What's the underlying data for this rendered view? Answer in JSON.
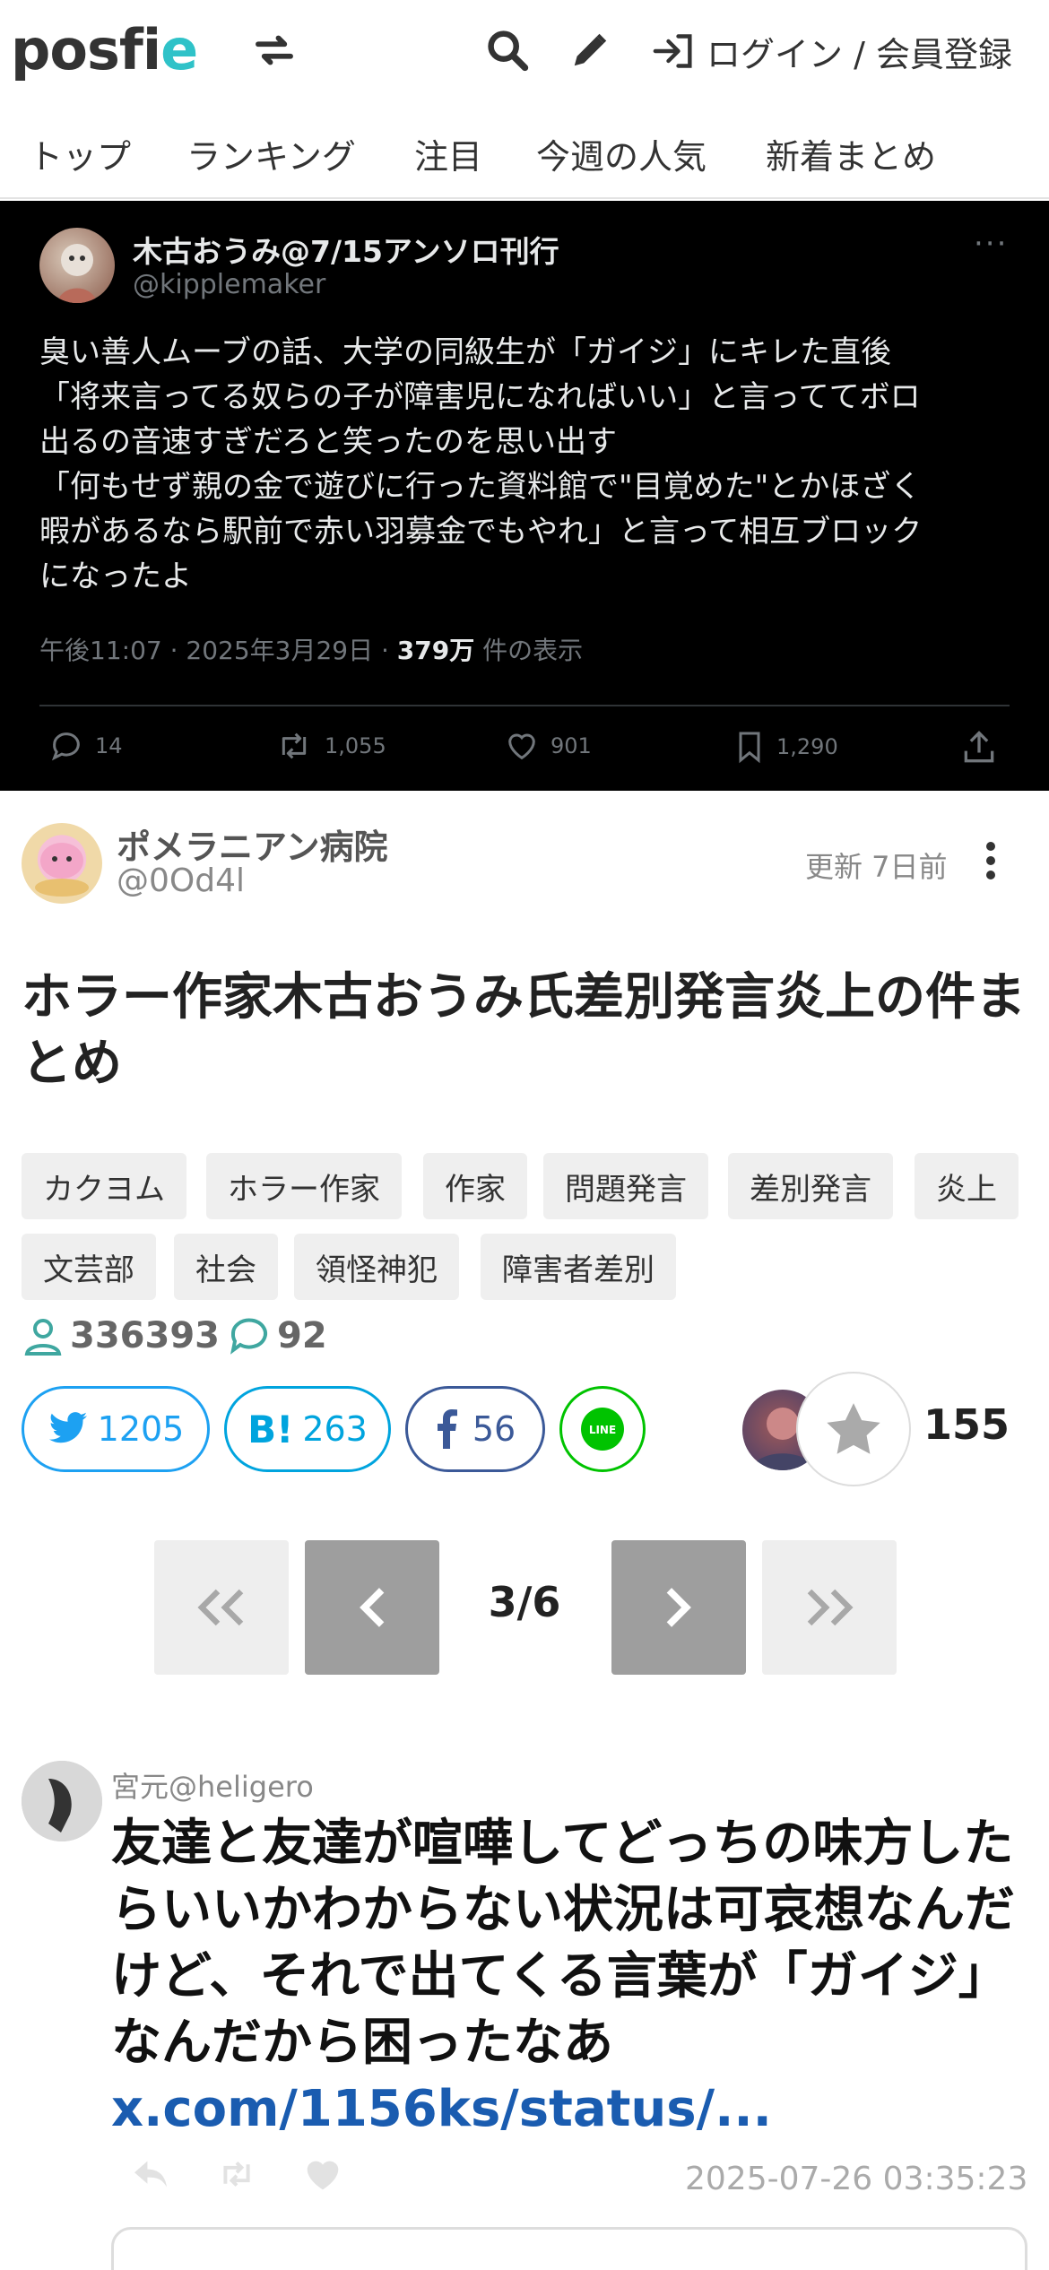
{
  "header": {
    "logo_main": "posfi",
    "logo_accent": "e",
    "login_label": "ログイン / 会員登録"
  },
  "nav": {
    "items": [
      "トップ",
      "ランキング",
      "注目",
      "今週の人気",
      "新着まとめ"
    ]
  },
  "tweet": {
    "name": "木古おうみ@7/15アンソロ刊行",
    "handle": "@kipplemaker",
    "body": "臭い善人ムーブの話、大学の同級生が「ガイジ」にキレた直後\n「将来言ってる奴らの子が障害児になればいい」と言っててボロ\n出るの音速すぎだろと笑ったのを思い出す\n「何もせず親の金で遊びに行った資料館で\"目覚めた\"とかほざく\n暇があるなら駅前で赤い羽募金でもやれ」と言って相互ブロック\nになったよ",
    "meta_prefix": "午後11:07 · 2025年3月29日 · ",
    "views": "379万",
    "views_suffix": " 件の表示",
    "replies": "14",
    "retweets": "1,055",
    "likes": "901",
    "bookmarks": "1,290"
  },
  "author": {
    "name": "ポメラニアン病院",
    "handle": "@0Od4l",
    "updated": "更新 7日前"
  },
  "title": "ホラー作家木古おうみ氏差別発言炎上の件まとめ",
  "tags": [
    "カクヨム",
    "ホラー作家",
    "作家",
    "問題発言",
    "差別発言",
    "炎上",
    "文芸部",
    "社会",
    "領怪神犯",
    "障害者差別"
  ],
  "stats": {
    "views": "336393",
    "comments": "92"
  },
  "share": {
    "twitter": "1205",
    "hatena_label": "B!",
    "hatena": "263",
    "facebook": "56",
    "line_label": "LINE",
    "favorites": "155"
  },
  "pagination": {
    "current": "3/6"
  },
  "post": {
    "user": "宮元@heligero",
    "text": "友達と友達が喧嘩してどっちの味方したらいいかわからない状況は可哀想なんだけど、それで出てくる言葉が「ガイジ」なんだから困ったなあ",
    "link": "x.com/1156ks/status/...",
    "date": "2025-07-26 03:35:23"
  },
  "colors": {
    "accent": "#2fc2c8",
    "twitter": "#1da1f2",
    "hatena": "#00a4de",
    "facebook": "#3b5998",
    "line": "#00c300",
    "link": "#1a5cb0"
  }
}
